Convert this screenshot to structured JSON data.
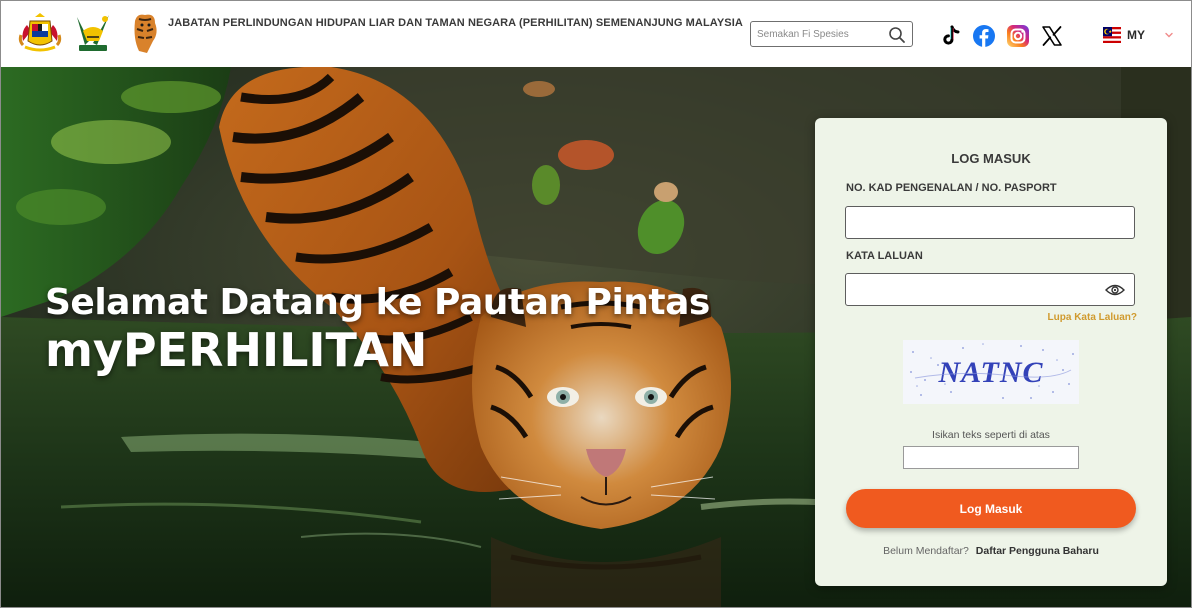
{
  "header": {
    "agency_name": "JABATAN PERLINDUNGAN HIDUPAN LIAR DAN TAMAN NEGARA (PERHILITAN) SEMENANJUNG MALAYSIA",
    "search": {
      "placeholder": "Semakan Fi Spesies",
      "value": "",
      "icon": "search-icon"
    },
    "social_icons": [
      "tiktok-icon",
      "facebook-icon",
      "instagram-icon",
      "x-icon"
    ],
    "language": {
      "label": "MY",
      "icon": "malaysia-flag-icon"
    }
  },
  "hero": {
    "line1": "Selamat Datang ke Pautan Pintas",
    "line2": "myPERHILITAN"
  },
  "login": {
    "title": "LOG MASUK",
    "ic_label": "NO. KAD PENGENALAN / NO. PASPORT",
    "ic_value": "",
    "password_label": "KATA LALUAN",
    "password_value": "",
    "forgot_password": "Lupa Kata Laluan?",
    "captcha_text": "NATNC",
    "captcha_hint": "Isikan teks seperti di atas",
    "captcha_value": "",
    "submit_label": "Log Masuk",
    "register_prompt": "Belum Mendaftar?",
    "register_link": "Daftar Pengguna Baharu"
  },
  "colors": {
    "accent": "#f05a1f",
    "link": "#d09a2e",
    "card_background": "#eef4e8"
  }
}
